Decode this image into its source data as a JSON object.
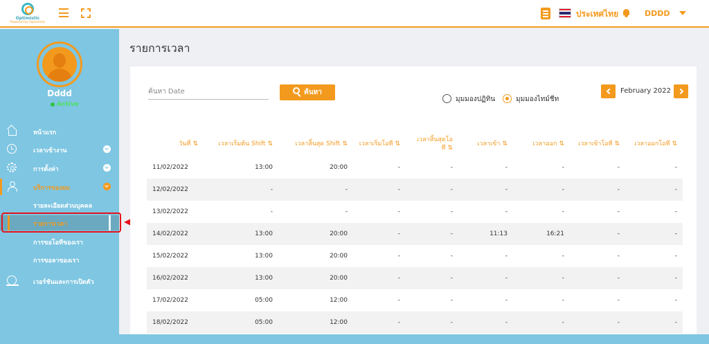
{
  "header": {
    "logo_name": "Optimistic",
    "logo_tagline": "Powered by Optimistic",
    "language": "ประเทศไทย",
    "username": "DDDD"
  },
  "sidebar": {
    "profile_name": "Dddd",
    "status": "Active",
    "items": [
      {
        "label": "หน้าแรก",
        "icon": "home-icon"
      },
      {
        "label": "เวลาเข้างาน",
        "icon": "clock-icon"
      },
      {
        "label": "การตั้งค่า",
        "icon": "gear-icon"
      },
      {
        "label": "บริการของผม",
        "icon": "user-icon"
      },
      {
        "label": "เวอร์ชันและการเปิดตัว",
        "icon": "version-icon"
      }
    ],
    "sub_items": [
      {
        "label": "รายละเอียดส่วนบุคคล"
      },
      {
        "label": "รายการเวลา"
      },
      {
        "label": "การขอโอทีของเรา"
      },
      {
        "label": "การขอลาของเรา"
      }
    ]
  },
  "page": {
    "title": "รายการเวลา",
    "search_placeholder": "ค้นหา Date",
    "search_button": "ค้นหา",
    "view_options": [
      {
        "label": "มุมมองปฏิทิน",
        "selected": false
      },
      {
        "label": "มุมมองไทม์ชีท",
        "selected": true
      }
    ],
    "month": "February 2022"
  },
  "table": {
    "sort_glyph": "⇅",
    "headers": [
      "วันที่",
      "เวลาเริ่มต้น Shift",
      "เวลาสิ้นสุด Shift",
      "เวลาเริ่มโอที",
      "เวลาสิ้นสุดโอที",
      "เวลาเข้า",
      "เวลาออก",
      "เวลาเข้าโอที",
      "เวลาออกโอที"
    ],
    "rows": [
      [
        "11/02/2022",
        "13:00",
        "20:00",
        "-",
        "-",
        "-",
        "-",
        "-",
        "-"
      ],
      [
        "12/02/2022",
        "-",
        "-",
        "-",
        "-",
        "-",
        "-",
        "-",
        "-"
      ],
      [
        "13/02/2022",
        "-",
        "-",
        "-",
        "-",
        "-",
        "-",
        "-",
        "-"
      ],
      [
        "14/02/2022",
        "13:00",
        "20:00",
        "-",
        "-",
        "11:13",
        "16:21",
        "-",
        "-"
      ],
      [
        "15/02/2022",
        "13:00",
        "20:00",
        "-",
        "-",
        "-",
        "-",
        "-",
        "-"
      ],
      [
        "16/02/2022",
        "13:00",
        "20:00",
        "-",
        "-",
        "-",
        "-",
        "-",
        "-"
      ],
      [
        "17/02/2022",
        "05:00",
        "12:00",
        "-",
        "-",
        "-",
        "-",
        "-",
        "-"
      ],
      [
        "18/02/2022",
        "05:00",
        "12:00",
        "-",
        "-",
        "-",
        "-",
        "-",
        "-"
      ]
    ]
  },
  "colors": {
    "accent": "#f39a1e",
    "sidebar": "#7ec6e2",
    "callout": "#e5131b"
  }
}
